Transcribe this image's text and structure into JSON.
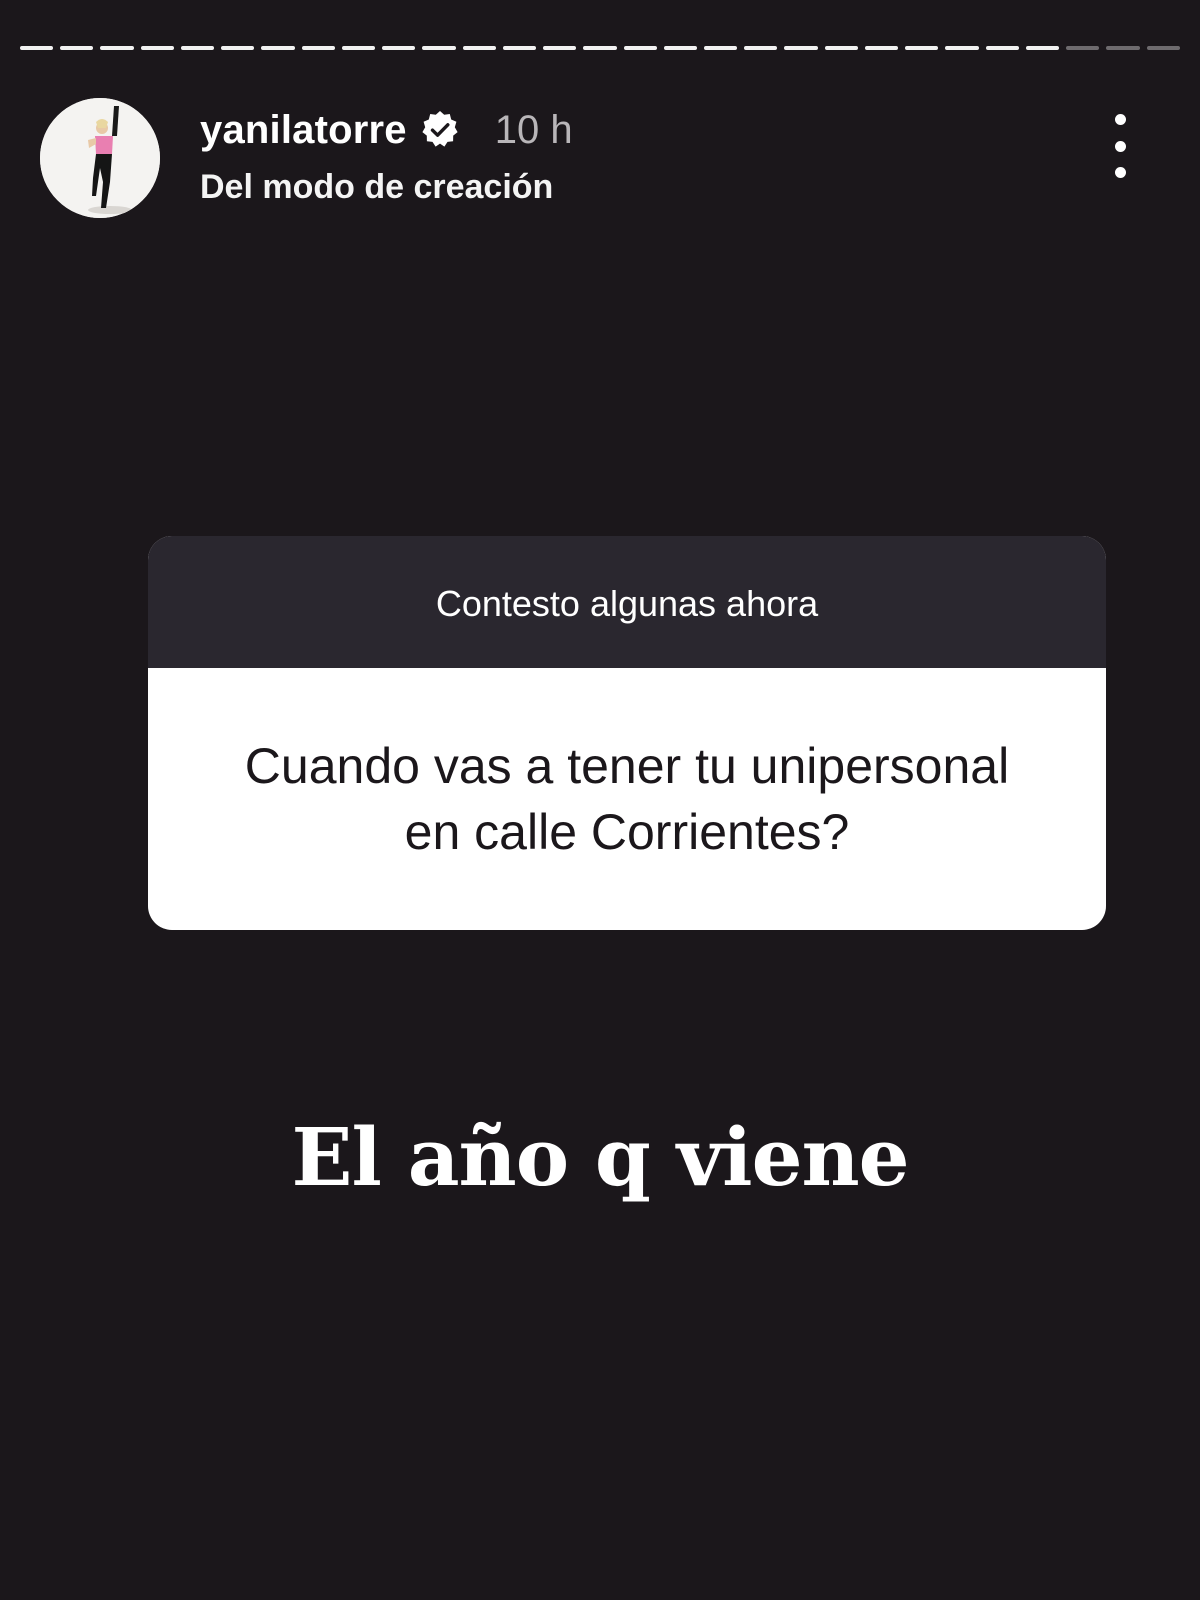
{
  "story": {
    "progress": {
      "segments_total": 29,
      "segments_completed": 26
    },
    "header": {
      "username": "yanilatorre",
      "verified": true,
      "timestamp": "10 h",
      "subtitle": "Del modo de creación"
    },
    "question_sticker": {
      "prompt": "Contesto algunas ahora",
      "question": "Cuando vas a tener tu unipersonal en calle Corrientes?"
    },
    "answer_text": "El año q viene"
  },
  "icons": {
    "verified": "verified-badge-icon",
    "more": "more-vertical-icon"
  },
  "colors": {
    "background": "#1b171b",
    "sticker_header": "#2a272f",
    "sticker_body": "#ffffff",
    "timestamp": "#b9b6b9"
  }
}
